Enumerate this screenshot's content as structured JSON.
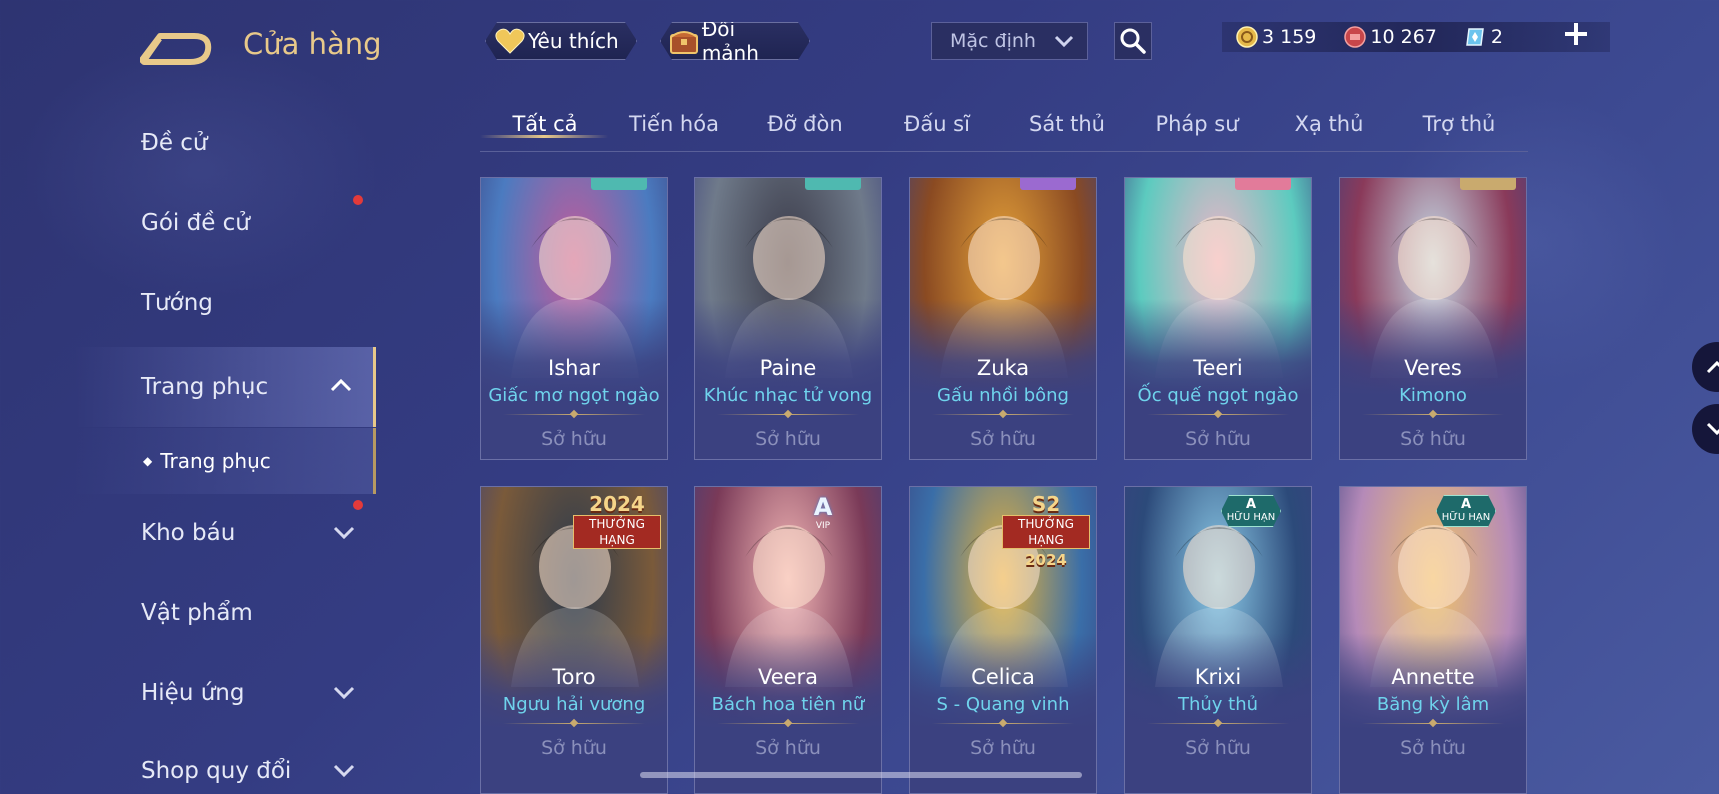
{
  "header": {
    "title": "Cửa hàng",
    "favorites_label": "Yêu thích",
    "shards_label": "Đổi mảnh",
    "sort_value": "Mặc định",
    "currency": [
      {
        "icon": "gold-coin-icon",
        "value": "3 159"
      },
      {
        "icon": "voucher-icon",
        "value": "10 267"
      },
      {
        "icon": "diamond-card-icon",
        "value": "2"
      }
    ]
  },
  "sidebar": {
    "items": [
      {
        "label": "Đề cử"
      },
      {
        "label": "Gói đề cử",
        "red_dot": true
      },
      {
        "label": "Tướng"
      },
      {
        "label": "Trang phục",
        "expanded": true
      },
      {
        "label": "Trang phục",
        "sub": true
      },
      {
        "label": "Kho báu",
        "red_dot": true
      },
      {
        "label": "Vật phẩm"
      },
      {
        "label": "Hiệu ứng"
      },
      {
        "label": "Shop quy đổi"
      }
    ]
  },
  "tabs": [
    "Tất cả",
    "Tiến hóa",
    "Đỡ đòn",
    "Đấu sĩ",
    "Sát thủ",
    "Pháp sư",
    "Xạ thủ",
    "Trợ thủ"
  ],
  "active_tab": "Tất cả",
  "cards": [
    {
      "hero": "Ishar",
      "skin": "Giấc mơ ngọt ngào",
      "status": "Sở hữu",
      "color_a": "#c45a9a",
      "color_b": "#4b7bc0"
    },
    {
      "hero": "Paine",
      "skin": "Khúc nhạc tử vong",
      "status": "Sở hữu",
      "color_a": "#3a3a48",
      "color_b": "#6f7a8a"
    },
    {
      "hero": "Zuka",
      "skin": "Gấu nhồi bông",
      "status": "Sở hữu",
      "color_a": "#e5a23a",
      "color_b": "#8a4a22"
    },
    {
      "hero": "Teeri",
      "skin": "Ốc quế ngọt ngào",
      "status": "Sở hữu",
      "color_a": "#f0b4c8",
      "color_b": "#5ccbbf"
    },
    {
      "hero": "Veres",
      "skin": "Kimono",
      "status": "Sở hữu",
      "color_a": "#c6dce8",
      "color_b": "#8a3a5a"
    },
    {
      "hero": "Toro",
      "skin": "Ngưu hải vương",
      "status": "Sở hữu",
      "color_a": "#2c3a4c",
      "color_b": "#7a5a3a",
      "badge": "rank",
      "badge_year": "2024",
      "badge_label": "THƯỞNG HẠNG"
    },
    {
      "hero": "Veera",
      "skin": "Bách hoa tiên nữ",
      "status": "Sở hữu",
      "color_a": "#f3b7b6",
      "color_b": "#7a3a58",
      "badge": "vip",
      "badge_letter": "A",
      "badge_sub": "VIP"
    },
    {
      "hero": "Celica",
      "skin": "S - Quang vinh",
      "status": "Sở hữu",
      "color_a": "#e8b33a",
      "color_b": "#3a6ea8",
      "badge": "rank",
      "badge_year": "S2",
      "badge_label": "THƯỞNG HẠNG",
      "badge_year2": "2024"
    },
    {
      "hero": "Krixi",
      "skin": "Thủy thủ",
      "status": "Sở hữu",
      "color_a": "#8ccbe8",
      "color_b": "#2c4a7a",
      "badge": "limited",
      "badge_letter": "A",
      "badge_sub": "HỮU HẠN"
    },
    {
      "hero": "Annette",
      "skin": "Băng kỳ lâm",
      "status": "Sở hữu",
      "color_a": "#f0c46a",
      "color_b": "#b58ab8",
      "badge": "limited",
      "badge_letter": "A",
      "badge_sub": "HỮU HẠN"
    }
  ]
}
